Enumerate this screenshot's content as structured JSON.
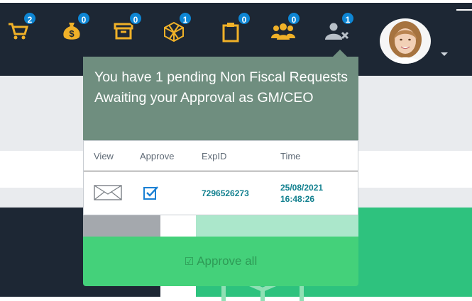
{
  "topbar": {
    "icons": [
      {
        "name": "cart-icon",
        "badge": "2"
      },
      {
        "name": "money-bag-icon",
        "badge": "0"
      },
      {
        "name": "archive-box-icon",
        "badge": "0"
      },
      {
        "name": "cube-icon",
        "badge": "1"
      },
      {
        "name": "clipboard-icon",
        "badge": "0"
      },
      {
        "name": "users-group-icon",
        "badge": "0"
      },
      {
        "name": "user-remove-icon",
        "badge": "1"
      }
    ],
    "icon_color": "#f0b128",
    "avatar": "profile-avatar",
    "menu_caret": "chevron-down-icon"
  },
  "popup": {
    "header_text": "You have 1 pending Non Fiscal Requests Awaiting your Approval as GM/CEO",
    "columns": [
      "View",
      "Approve",
      "ExpID",
      "Time"
    ],
    "rows": [
      {
        "view_icon": "envelope-icon",
        "approve_icon": "checkbox-icon",
        "exp_id": "7296526273",
        "time_date": "25/08/2021",
        "time_clock": "16:48:26"
      }
    ],
    "approve_all_label": "Approve all",
    "header_bg": "#6f8e7f",
    "approve_all_bg": "#44d17a",
    "id_color": "#12808f"
  }
}
